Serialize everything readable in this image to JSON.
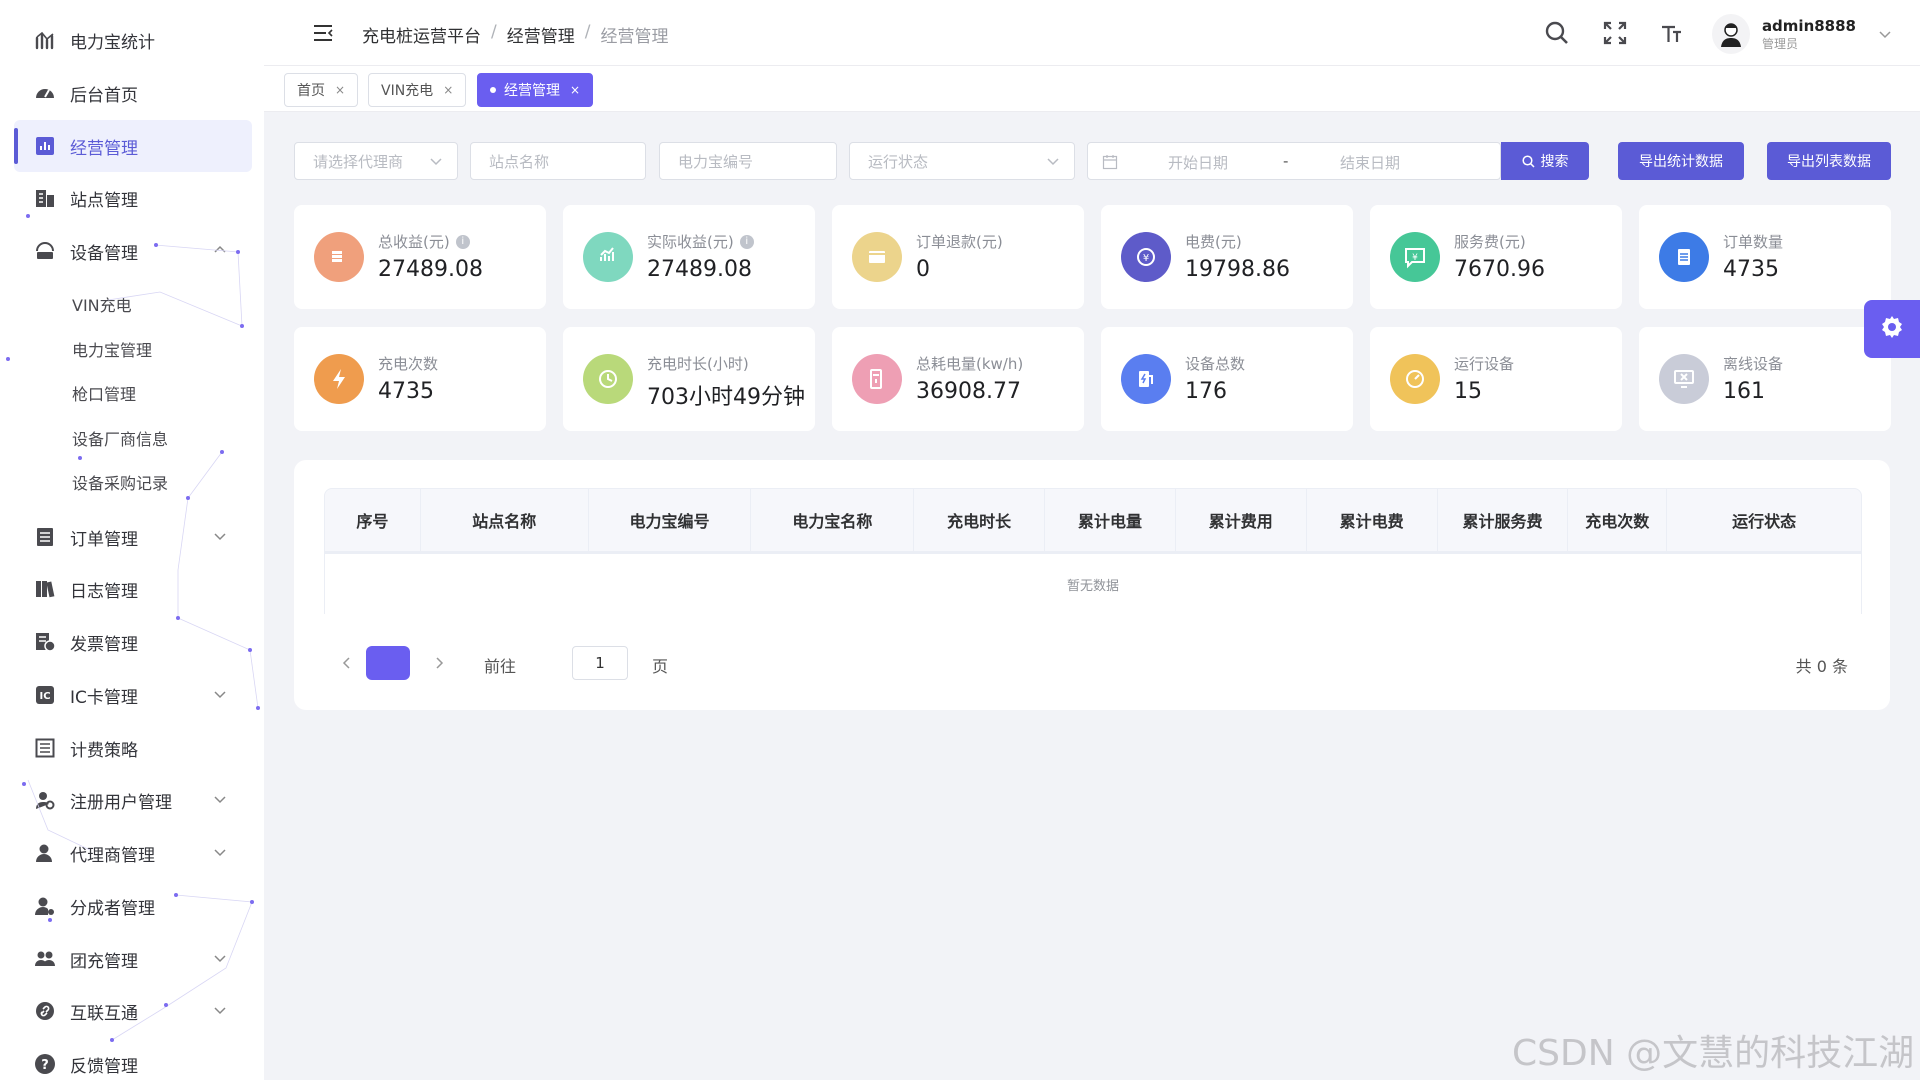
{
  "sidebar": {
    "items": [
      {
        "label": "电力宝统计",
        "icon": "bar-chart-icon"
      },
      {
        "label": "后台首页",
        "icon": "dashboard-gauge-icon"
      },
      {
        "label": "经营管理",
        "icon": "business-chart-icon"
      },
      {
        "label": "站点管理",
        "icon": "building-icon"
      },
      {
        "label": "设备管理",
        "icon": "device-icon"
      },
      {
        "label": "订单管理",
        "icon": "order-list-icon"
      },
      {
        "label": "日志管理",
        "icon": "books-icon"
      },
      {
        "label": "发票管理",
        "icon": "invoice-icon"
      },
      {
        "label": "IC卡管理",
        "icon": "ic-card-icon"
      },
      {
        "label": "计费策略",
        "icon": "billing-list-icon"
      },
      {
        "label": "注册用户管理",
        "icon": "user-settings-icon"
      },
      {
        "label": "代理商管理",
        "icon": "agent-icon"
      },
      {
        "label": "分成者管理",
        "icon": "share-user-icon"
      },
      {
        "label": "团充管理",
        "icon": "group-icon"
      },
      {
        "label": "互联互通",
        "icon": "link-icon"
      },
      {
        "label": "反馈管理",
        "icon": "question-icon"
      }
    ],
    "device_sub": [
      "VIN充电",
      "电力宝管理",
      "枪口管理",
      "设备厂商信息",
      "设备采购记录"
    ]
  },
  "header": {
    "breadcrumb": [
      "充电桩运营平台",
      "经营管理",
      "经营管理"
    ],
    "username": "admin8888",
    "role": "管理员"
  },
  "tabs": [
    {
      "label": "首页"
    },
    {
      "label": "VIN充电"
    },
    {
      "label": "经营管理"
    }
  ],
  "filters": {
    "agent_placeholder": "请选择代理商",
    "station_placeholder": "站点名称",
    "power_bank_placeholder": "电力宝编号",
    "status_placeholder": "运行状态",
    "start_date_placeholder": "开始日期",
    "date_sep": "-",
    "end_date_placeholder": "结束日期",
    "search_label": "搜索",
    "export_stats_label": "导出统计数据",
    "export_list_label": "导出列表数据"
  },
  "stats": [
    {
      "title": "总收益(元)",
      "value": "27489.08",
      "info": true,
      "color": "#f0a07c",
      "icon": "coins-icon"
    },
    {
      "title": "实际收益(元)",
      "value": "27489.08",
      "info": true,
      "color": "#7fd8bf",
      "icon": "growth-chart-icon"
    },
    {
      "title": "订单退款(元)",
      "value": "0",
      "info": false,
      "color": "#ecd48c",
      "icon": "refund-card-icon"
    },
    {
      "title": "电费(元)",
      "value": "19798.86",
      "info": false,
      "color": "#5e5bc9",
      "icon": "yuan-cycle-icon"
    },
    {
      "title": "服务费(元)",
      "value": "7670.96",
      "info": false,
      "color": "#46c797",
      "icon": "yuan-message-icon"
    },
    {
      "title": "订单数量",
      "value": "4735",
      "info": false,
      "color": "#3d7be6",
      "icon": "clipboard-icon"
    },
    {
      "title": "充电次数",
      "value": "4735",
      "info": false,
      "color": "#ef9c4e",
      "icon": "lightning-icon"
    },
    {
      "title": "充电时长(小时)",
      "value": "703小时49分钟",
      "info": false,
      "color": "#b9d97a",
      "icon": "clock-history-icon"
    },
    {
      "title": "总耗电量(kw/h)",
      "value": "36908.77",
      "info": false,
      "color": "#ee9fb4",
      "icon": "charger-pile-icon"
    },
    {
      "title": "设备总数",
      "value": "176",
      "info": false,
      "color": "#5a7ef0",
      "icon": "charging-station-icon"
    },
    {
      "title": "运行设备",
      "value": "15",
      "info": false,
      "color": "#f0c35a",
      "icon": "running-gauge-icon"
    },
    {
      "title": "离线设备",
      "value": "161",
      "info": false,
      "color": "#c9ccd8",
      "icon": "offline-monitor-icon"
    }
  ],
  "table": {
    "columns": [
      "序号",
      "站点名称",
      "电力宝编号",
      "电力宝名称",
      "充电时长",
      "累计电量",
      "累计费用",
      "累计电费",
      "累计服务费",
      "充电次数",
      "运行状态"
    ],
    "empty_text": "暂无数据"
  },
  "pagination": {
    "current_page": "1",
    "goto_label": "前往",
    "input_value": "1",
    "page_label": "页",
    "total_text": "共 0 条"
  },
  "watermark": "CSDN @文慧的科技江湖"
}
